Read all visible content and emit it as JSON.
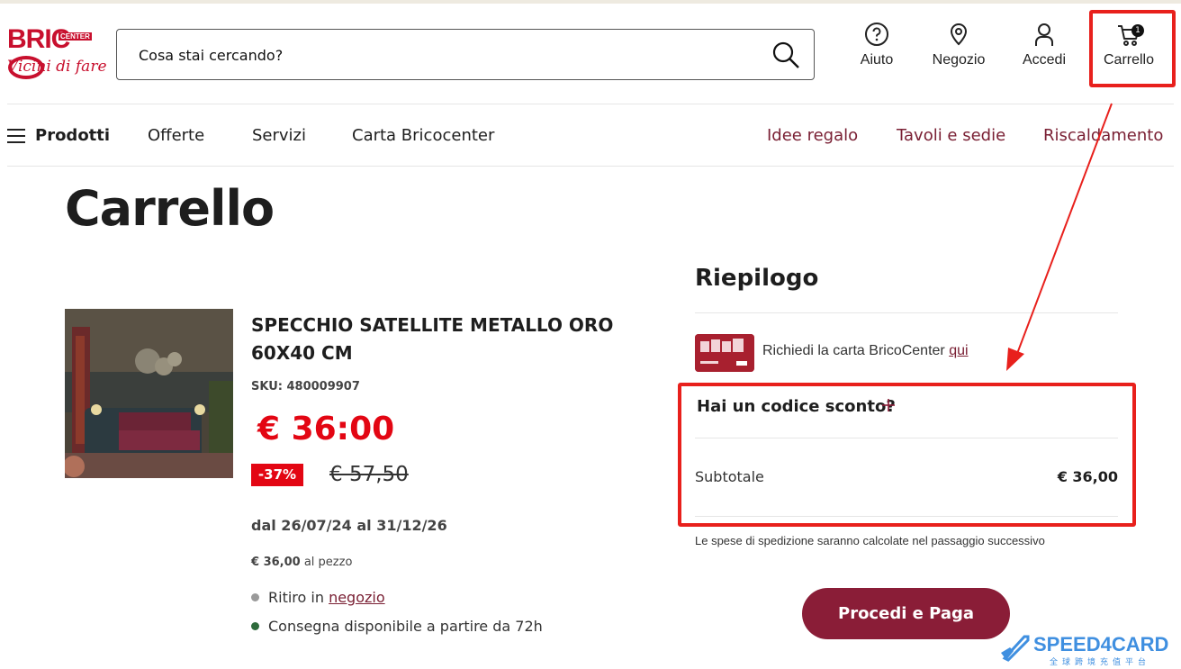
{
  "logo": {
    "brand": "BRIC",
    "center": "CENTER",
    "tagline": "Vicini di fare"
  },
  "search": {
    "placeholder": "Cosa stai cercando?"
  },
  "header_actions": {
    "help": "Aiuto",
    "store": "Negozio",
    "login": "Accedi",
    "cart": "Carrello",
    "cart_count": "1"
  },
  "nav": {
    "left": [
      "Prodotti",
      "Offerte",
      "Servizi",
      "Carta Bricocenter"
    ],
    "right": [
      "Idee regalo",
      "Tavoli e sedie",
      "Riscaldamento"
    ]
  },
  "page_title": "Carrello",
  "product": {
    "name": "SPECCHIO SATELLITE METALLO ORO 60X40 CM",
    "sku": "SKU: 480009907",
    "price": "€ 36:00",
    "discount": "-37%",
    "old_price": "€ 57,50",
    "dates": "dal 26/07/24 al 31/12/26",
    "per_piece_value": "€ 36,00",
    "per_piece_suffix": " al pezzo",
    "pickup_prefix": "Ritiro in ",
    "pickup_link": "negozio",
    "delivery": "Consegna disponibile a partire da 72h"
  },
  "summary": {
    "title": "Riepilogo",
    "card_prefix": "Richiedi la carta BricoCenter ",
    "card_link": "qui",
    "discount_code": "Hai un codice sconto?",
    "subtotal_label": "Subtotale",
    "subtotal_value": "€ 36,00",
    "shipping_note": "Le spese di spedizione saranno calcolate nel passaggio successivo",
    "pay_button": "Procedi e Paga"
  },
  "colors": {
    "brand_red": "#c8102e",
    "price_red": "#e30613",
    "burgundy": "#8a1d37",
    "annotation_red": "#e8201c"
  },
  "watermark": {
    "text": "SPEED4CARD",
    "sub": "全球跨境充值平台"
  }
}
